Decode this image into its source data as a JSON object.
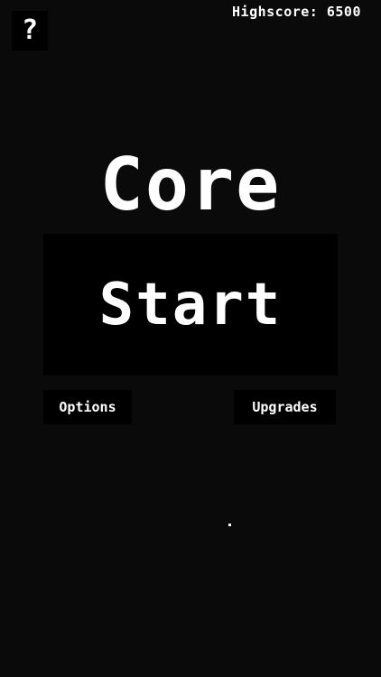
{
  "help": {
    "label": "?"
  },
  "highscore": {
    "text": "Highscore: 6500"
  },
  "title": {
    "text": "Core"
  },
  "menu": {
    "start_label": "Start",
    "options_label": "Options",
    "upgrades_label": "Upgrades"
  },
  "colors": {
    "background": "#0a0a0a",
    "button": "#000000",
    "text": "#ffffff"
  }
}
